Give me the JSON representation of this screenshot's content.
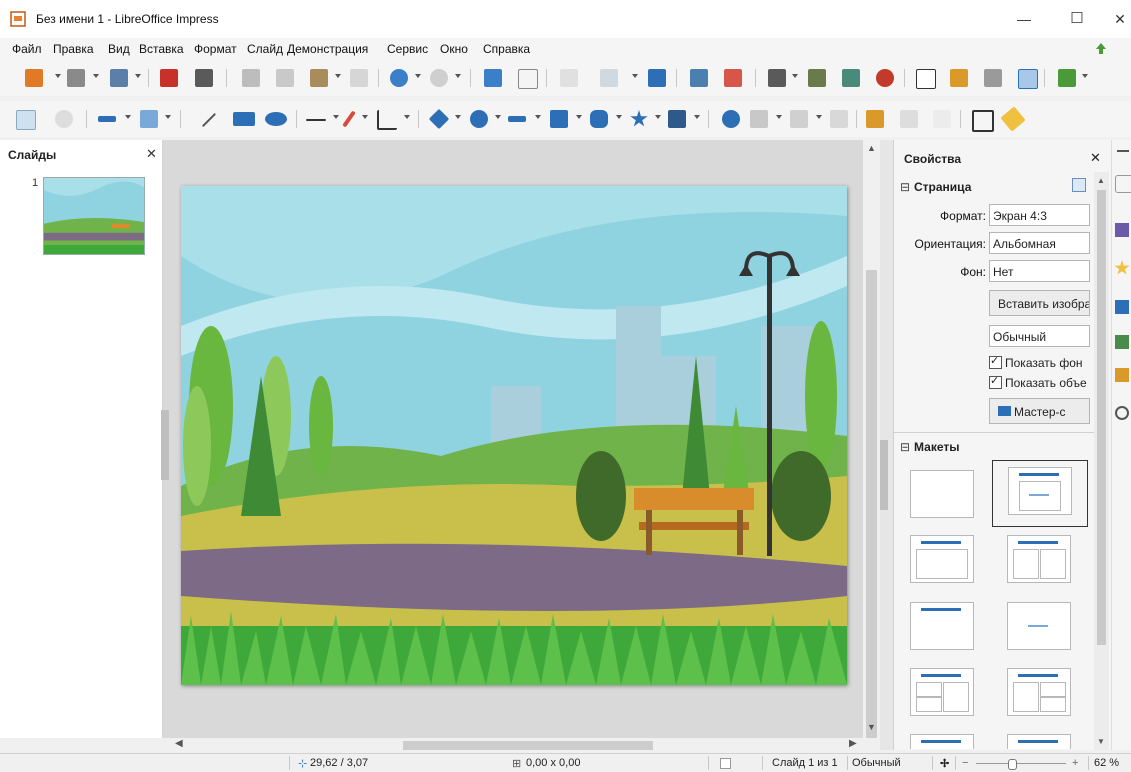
{
  "window": {
    "title": "Без имени 1 - LibreOffice Impress",
    "minimize": "—",
    "maximize": "☐",
    "close": "✕"
  },
  "menu": [
    {
      "label": "Файл"
    },
    {
      "label": "Правка"
    },
    {
      "label": "Вид"
    },
    {
      "label": "Вставка"
    },
    {
      "label": "Формат"
    },
    {
      "label": "Слайд"
    },
    {
      "label": "Демонстрация"
    },
    {
      "label": "Сервис"
    },
    {
      "label": "Окно"
    },
    {
      "label": "Справка"
    }
  ],
  "slides_pane": {
    "title": "Слайды",
    "close": "✕",
    "slide_number": "1"
  },
  "properties": {
    "title": "Свойства",
    "close": "✕",
    "page_section": "Страница",
    "format_label": "Формат:",
    "format_value": "Экран 4:3",
    "orientation_label": "Ориентация:",
    "orientation_value": "Альбомная",
    "background_label": "Фон:",
    "background_value": "Нет",
    "insert_image_button": "Вставить изобра",
    "master_value": "Обычный",
    "show_background": "Показать фон",
    "show_objects": "Показать объе",
    "master_slide_button": "Мастер-с",
    "layouts_section": "Макеты"
  },
  "statusbar": {
    "position": "29,62 / 3,07",
    "size": "0,00 x 0,00",
    "slide": "Слайд 1 из 1",
    "master": "Обычный",
    "zoom": "62 %"
  },
  "colors": {
    "sky": "#8fd3e0",
    "grass": "#4caf50",
    "path": "#7d6a86",
    "bench": "#d98c2b",
    "accent": "#2d6fb7"
  }
}
